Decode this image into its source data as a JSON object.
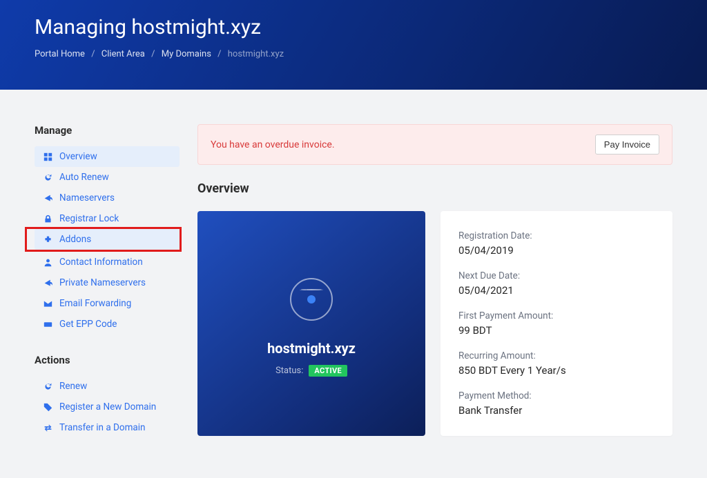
{
  "hero": {
    "title": "Managing hostmight.xyz",
    "breadcrumb": [
      "Portal Home",
      "Client Area",
      "My Domains"
    ],
    "breadcrumb_current": "hostmight.xyz"
  },
  "sidebar": {
    "manage_heading": "Manage",
    "actions_heading": "Actions",
    "manage": [
      {
        "label": "Overview",
        "icon": "dashboard",
        "active": true
      },
      {
        "label": "Auto Renew",
        "icon": "refresh",
        "active": false
      },
      {
        "label": "Nameservers",
        "icon": "share",
        "active": false
      },
      {
        "label": "Registrar Lock",
        "icon": "lock",
        "active": false
      },
      {
        "label": "Addons",
        "icon": "puzzle",
        "active": true
      },
      {
        "label": "Contact Information",
        "icon": "user",
        "active": false
      },
      {
        "label": "Private Nameservers",
        "icon": "share",
        "active": false
      },
      {
        "label": "Email Forwarding",
        "icon": "mail",
        "active": false
      },
      {
        "label": "Get EPP Code",
        "icon": "ticket",
        "active": false
      }
    ],
    "actions": [
      {
        "label": "Renew",
        "icon": "refresh"
      },
      {
        "label": "Register a New Domain",
        "icon": "tag"
      },
      {
        "label": "Transfer in a Domain",
        "icon": "swap"
      }
    ]
  },
  "alert": {
    "message": "You have an overdue invoice.",
    "button": "Pay Invoice"
  },
  "overview": {
    "heading": "Overview",
    "domain": "hostmight.xyz",
    "status_label": "Status:",
    "status_value": "ACTIVE",
    "fields": [
      {
        "label": "Registration Date:",
        "value": "05/04/2019"
      },
      {
        "label": "Next Due Date:",
        "value": "05/04/2021"
      },
      {
        "label": "First Payment Amount:",
        "value": "99 BDT"
      },
      {
        "label": "Recurring Amount:",
        "value": "850 BDT Every 1 Year/s"
      },
      {
        "label": "Payment Method:",
        "value": "Bank Transfer"
      }
    ]
  },
  "highlight": {
    "box_covers_item_index": 4
  }
}
